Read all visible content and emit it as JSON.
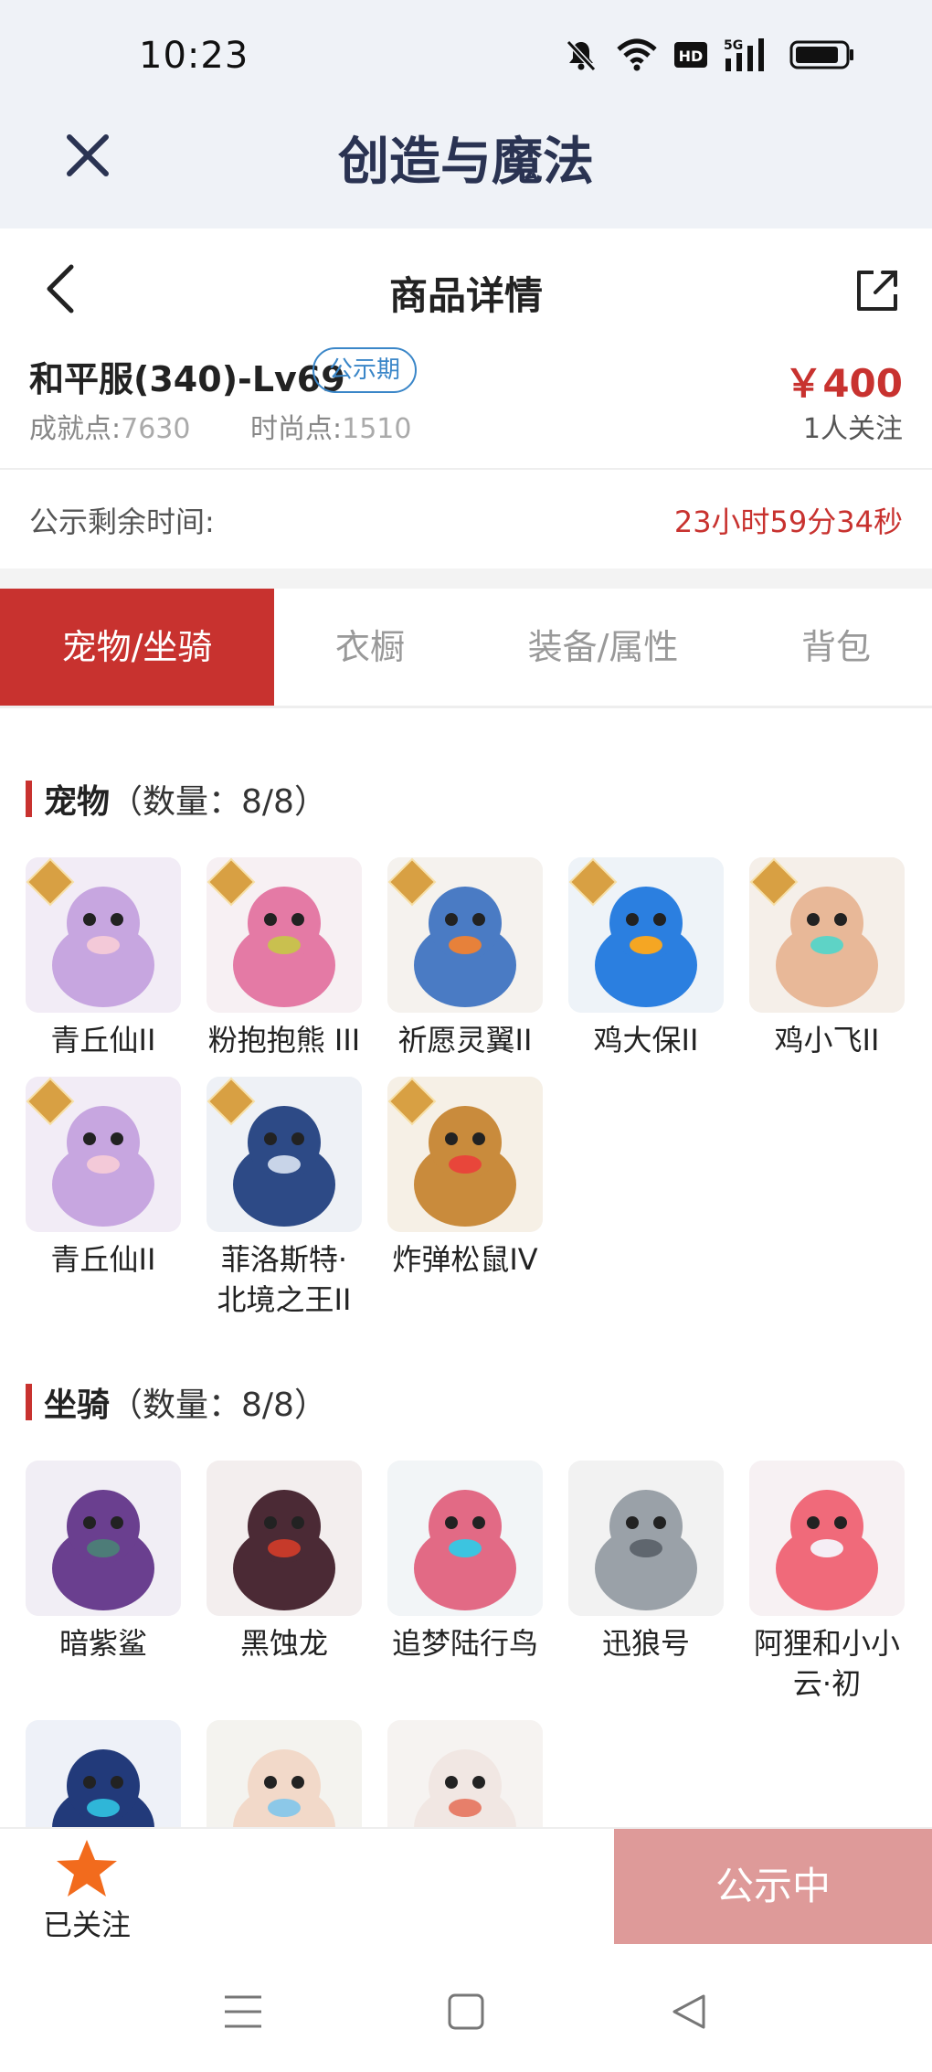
{
  "status": {
    "time": "10:23"
  },
  "app": {
    "title": "创造与魔法"
  },
  "nav": {
    "title": "商品详情"
  },
  "product": {
    "name": "和平服(340)-Lv69",
    "badge": "公示期",
    "price": "￥400",
    "achievement_label": "成就点:",
    "achievement_value": "7630",
    "fashion_label": "时尚点:",
    "fashion_value": "1510",
    "followers": "1人关注"
  },
  "countdown": {
    "label": "公示剩余时间:",
    "value": "23小时59分34秒"
  },
  "tabs": [
    {
      "label": "宠物/坐骑",
      "active": true
    },
    {
      "label": "衣橱"
    },
    {
      "label": "装备/属性"
    },
    {
      "label": "背包"
    }
  ],
  "pets": {
    "title": "宠物",
    "count": "（数量：8/8）",
    "items": [
      {
        "name": "青丘仙II",
        "rank": "II"
      },
      {
        "name": "粉抱抱熊 III",
        "rank": "III"
      },
      {
        "name": "祈愿灵翼II",
        "rank": "II"
      },
      {
        "name": "鸡大保II",
        "rank": "II"
      },
      {
        "name": "鸡小飞II",
        "rank": "II"
      },
      {
        "name": "青丘仙II",
        "rank": "II"
      },
      {
        "name": "菲洛斯特·北境之王II",
        "rank": "II"
      },
      {
        "name": "炸弹松鼠IV",
        "rank": "IV"
      }
    ]
  },
  "mounts": {
    "title": "坐骑",
    "count": "（数量：8/8）",
    "items": [
      {
        "name": "暗紫鲨"
      },
      {
        "name": "黑蚀龙"
      },
      {
        "name": "追梦陆行鸟"
      },
      {
        "name": "迅狼号"
      },
      {
        "name": "阿狸和小小云·初"
      },
      {
        "name": ""
      },
      {
        "name": ""
      },
      {
        "name": ""
      }
    ]
  },
  "bottom": {
    "follow_label": "已关注",
    "action_label": "公示中"
  },
  "colors": {
    "accent": "#c8322f",
    "badge": "#3a86c8",
    "action": "#de9a99",
    "star": "#f26b1d"
  }
}
